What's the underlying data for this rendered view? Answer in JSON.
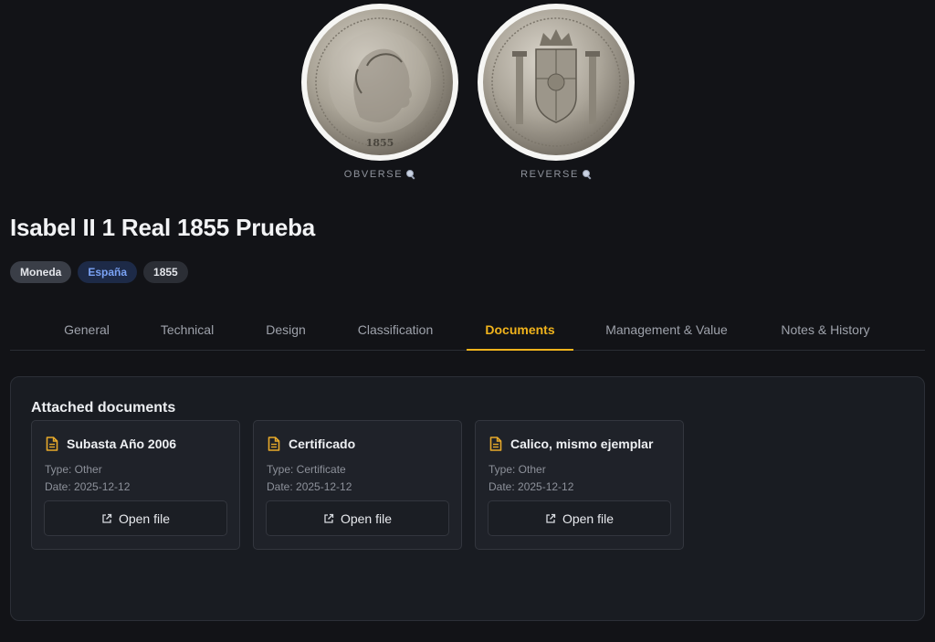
{
  "coin": {
    "obverse_caption": "OBVERSE",
    "reverse_caption": "REVERSE"
  },
  "title": "Isabel II 1 Real 1855 Prueba",
  "chips": {
    "type": "Moneda",
    "country": "España",
    "year": "1855"
  },
  "tabs": [
    {
      "label": "General"
    },
    {
      "label": "Technical"
    },
    {
      "label": "Design"
    },
    {
      "label": "Classification"
    },
    {
      "label": "Documents"
    },
    {
      "label": "Management & Value"
    },
    {
      "label": "Notes & History"
    }
  ],
  "active_tab": "Documents",
  "documents": {
    "heading": "Attached documents",
    "open_label": "Open file",
    "items": [
      {
        "name": "Subasta Año 2006",
        "type": "Type: Other",
        "date": "Date: 2025-12-12"
      },
      {
        "name": "Certificado",
        "type": "Type: Certificate",
        "date": "Date: 2025-12-12"
      },
      {
        "name": "Calico, mismo ejemplar",
        "type": "Type: Other",
        "date": "Date: 2025-12-12"
      }
    ]
  },
  "colors": {
    "background": "#121317",
    "panel": "#191c22",
    "accent": "#f0b31c",
    "country_chip_text": "#7aa2f4",
    "doc_icon": "#e7a92a"
  },
  "icons": {
    "caption_icon": "magnifier-icon",
    "doc_icon": "document-icon",
    "open_icon": "external-link-icon"
  }
}
